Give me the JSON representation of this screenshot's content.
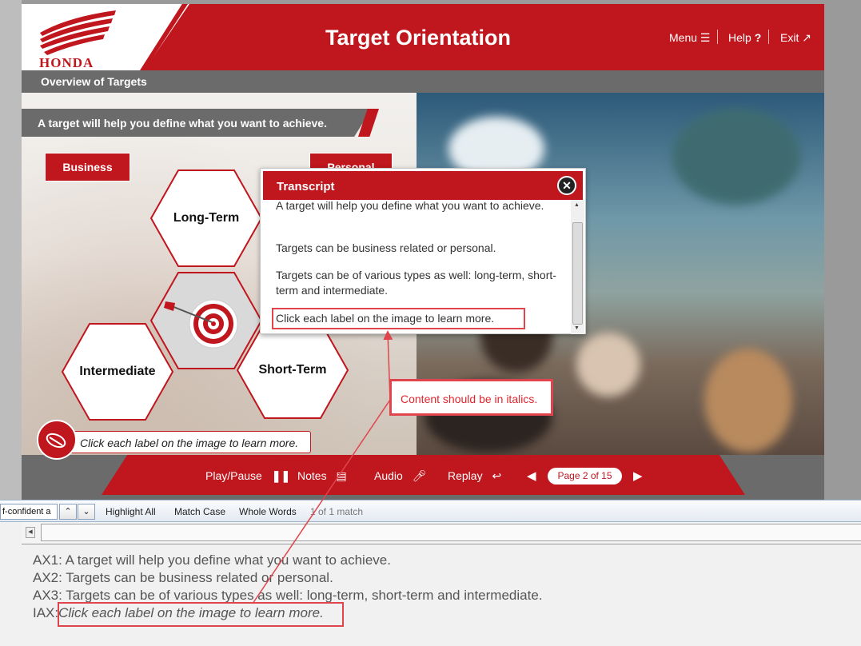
{
  "header": {
    "logo_text": "HONDA",
    "title": "Target Orientation",
    "menu": "Menu",
    "help": "Help",
    "exit": "Exit"
  },
  "subheader": {
    "title": "Overview of Targets"
  },
  "content": {
    "banner": "A target will help you define what you want to achieve.",
    "business": "Business",
    "personal": "Personal",
    "hex_long": "Long-Term",
    "hex_intermediate": "Intermediate",
    "hex_short": "Short-Term",
    "instruction": "Click each label on the image to learn more."
  },
  "transcript": {
    "title": "Transcript",
    "close": "✕",
    "p1": "A target will help you define what you want to achieve.",
    "p2": "Targets can be business related or personal.",
    "p3": "Targets can be of various types as well: long-term, short-term and intermediate.",
    "p4": "Click each label on the image to learn more."
  },
  "annotation": {
    "note": "Content should be in italics."
  },
  "nav": {
    "play_pause": "Play/Pause",
    "notes": "Notes",
    "audio": "Audio",
    "replay": "Replay",
    "page": "Page 2 of 15"
  },
  "findbar": {
    "query": "f-confident a",
    "highlight_all": "Highlight All",
    "match_case": "Match Case",
    "whole_words": "Whole Words",
    "count": "1 of 1 match"
  },
  "text_pane": {
    "lines": [
      {
        "prefix": "AX1:",
        "text": "A target will help you define what you want to achieve."
      },
      {
        "prefix": "AX2:",
        "text": "Targets can be business related or personal."
      },
      {
        "prefix": "AX3:",
        "text": "Targets can be of various types as well: long-term, short-term and intermediate."
      },
      {
        "prefix": "IAX:",
        "text": "Click each label on the image to learn more."
      }
    ]
  },
  "colors": {
    "brand_red": "#c0161d",
    "annotation_red": "#e0454d",
    "gray": "#6b6b6b"
  }
}
